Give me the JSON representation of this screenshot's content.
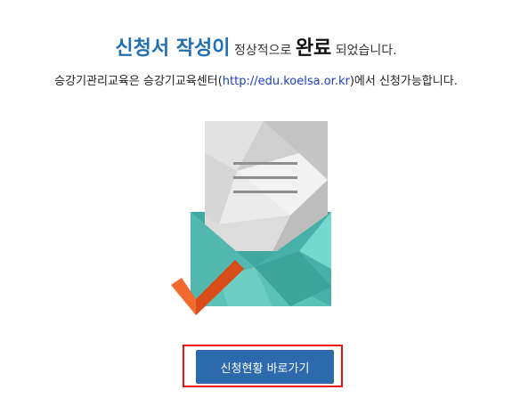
{
  "headline": {
    "part1": "신청서 작성이",
    "part2": " 정상적으로 ",
    "part3": "완료",
    "part4": " 되었습니다."
  },
  "subline": {
    "prefix": "승강기관리교육은 승강기교육센터(",
    "link": "http://edu.koelsa.or.kr",
    "suffix": ")에서 신청가능합니다."
  },
  "illustration": {
    "icon": "envelope-letter-checkmark-icon",
    "colors": {
      "envelope": "#4db8b0",
      "letter": "#e8e8e8",
      "check": "#f26a2e"
    }
  },
  "actions": {
    "status_button": "신청현황 바로가기"
  },
  "colors": {
    "accent_blue": "#1f6fb4",
    "button_bg": "#2d6aad",
    "highlight_frame": "#ee1111"
  }
}
